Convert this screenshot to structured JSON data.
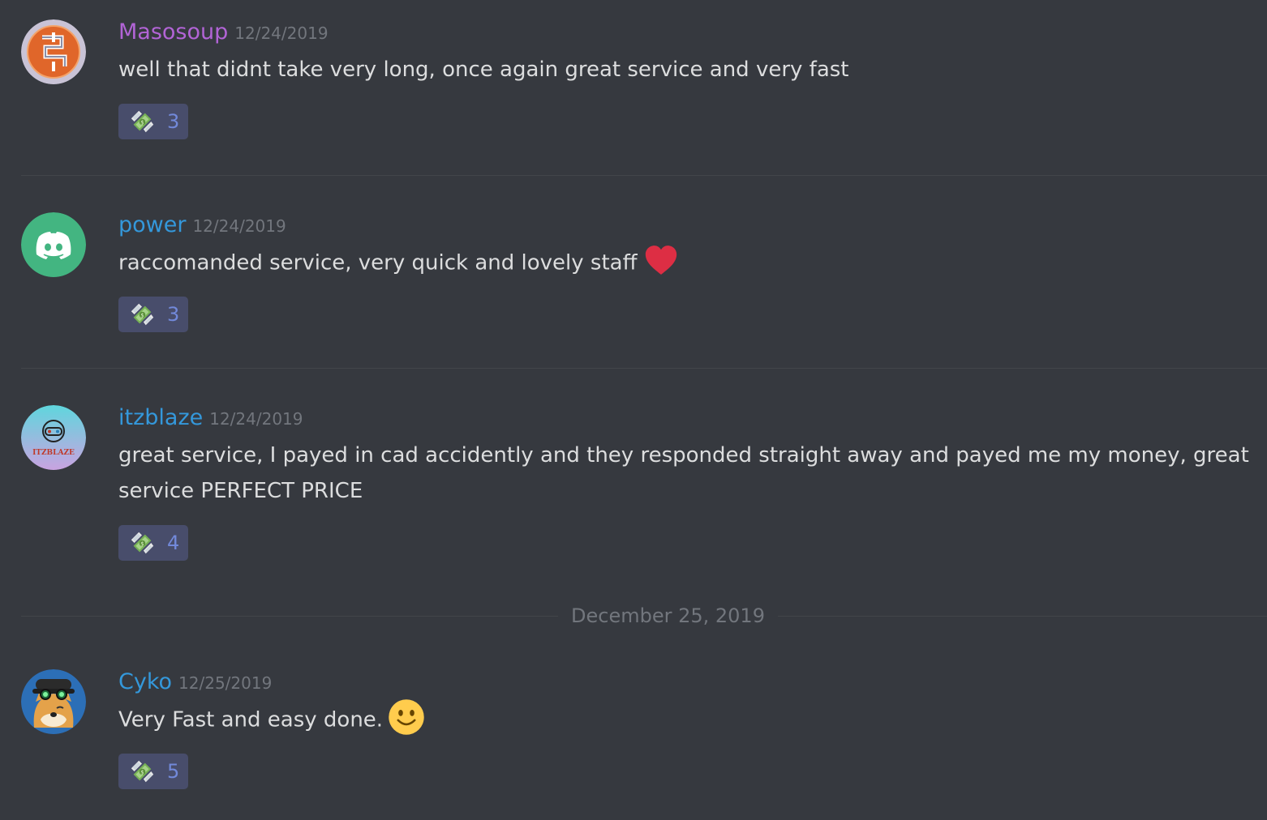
{
  "colors": {
    "background": "#36393f",
    "message_text": "#dcddde",
    "timestamp": "#72767d",
    "reaction_bg": "#484d6b",
    "reaction_count": "#7289da",
    "divider": "#42454a"
  },
  "messages": [
    {
      "username": "Masosoup",
      "username_color": "#b264d6",
      "timestamp": "12/24/2019",
      "text": "well that didnt take very long, once again great service and very fast",
      "avatar": "masosoup-avatar",
      "reaction": {
        "icon": "money-with-wings-icon",
        "count": "3"
      }
    },
    {
      "username": "power",
      "username_color": "#3498db",
      "timestamp": "12/24/2019",
      "text": "raccomanded service, very quick and lovely staff",
      "emoji": "red-heart-emoji",
      "avatar": "discord-logo-avatar",
      "reaction": {
        "icon": "money-with-wings-icon",
        "count": "3"
      }
    },
    {
      "username": "itzblaze",
      "username_color": "#3498db",
      "timestamp": "12/24/2019",
      "text": "great service, I payed in cad accidently and they responded straight away and payed me my money, great service PERFECT PRICE",
      "avatar": "itzblaze-avatar",
      "avatar_label": "ITZBLAZE",
      "reaction": {
        "icon": "money-with-wings-icon",
        "count": "4"
      }
    },
    {
      "username": "Cyko",
      "username_color": "#3498db",
      "timestamp": "12/25/2019",
      "text": "Very Fast and easy done.",
      "emoji": "slightly-smiling-face-emoji",
      "avatar": "shiba-dog-avatar",
      "reaction": {
        "icon": "money-with-wings-icon",
        "count": "5"
      }
    }
  ],
  "date_divider": {
    "label": "December 25, 2019"
  }
}
